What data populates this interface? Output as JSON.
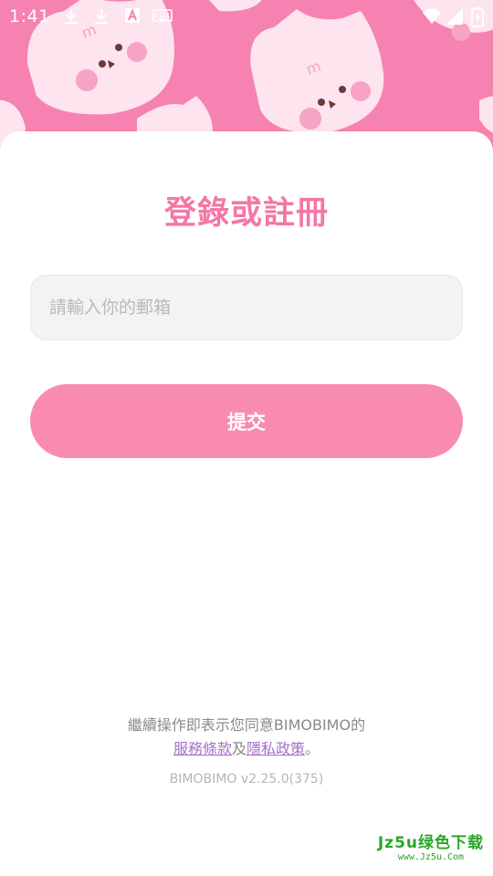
{
  "status_bar": {
    "time": "1:41",
    "left_icons": [
      "download-icon",
      "download-icon",
      "text-a-icon",
      "keyboard-icon"
    ],
    "right_icons": [
      "wifi-icon",
      "signal-icon",
      "battery-charging-icon"
    ]
  },
  "colors": {
    "hero_pink": "#f582b0",
    "title_pink": "#f477a6",
    "button_pink": "#f98bb1",
    "link_purple": "#a570c8"
  },
  "login": {
    "title": "登錄或註冊",
    "email_placeholder": "請輸入你的郵箱",
    "email_value": "",
    "submit_label": "提交"
  },
  "footer": {
    "agreement_prefix": "繼續操作即表示您同意BIMOBIMO的",
    "terms_link": "服務條款",
    "conjunction": "及",
    "privacy_link": "隱私政策",
    "period": "。",
    "version": "BIMOBIMO v2.25.0(375)"
  },
  "watermark": {
    "main": "Jz5u绿色下载",
    "sub": "www.Jz5u.Com"
  }
}
